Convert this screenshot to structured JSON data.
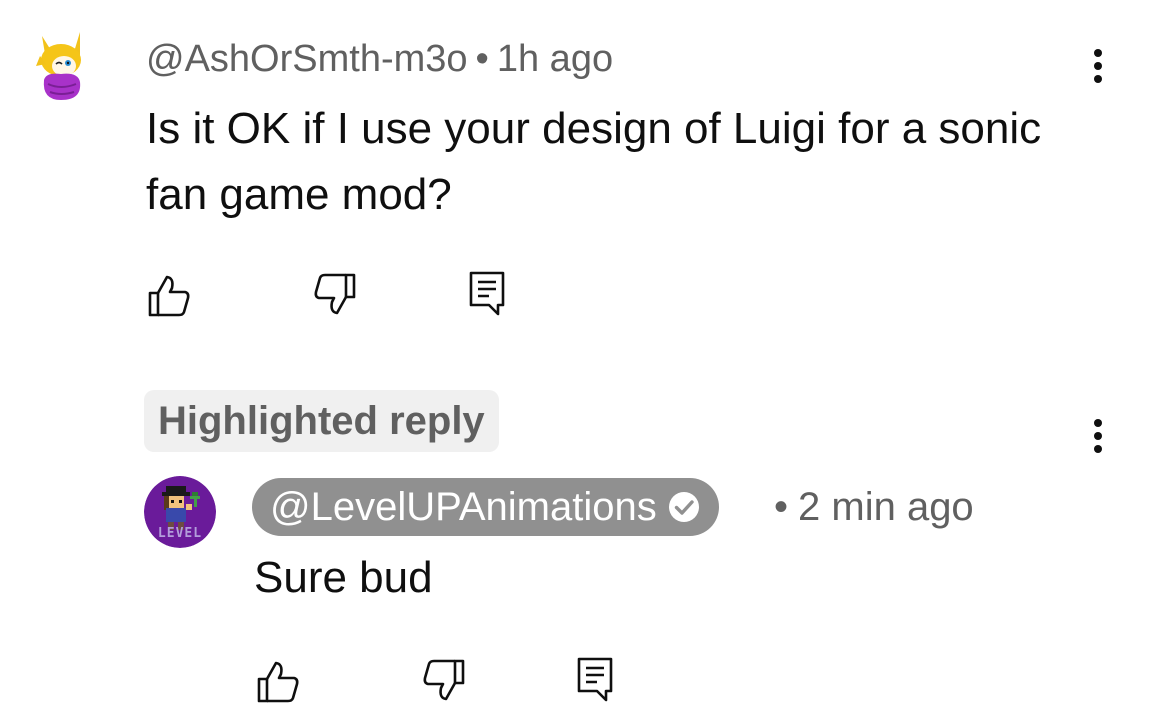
{
  "comment": {
    "author": "@AshOrSmth-m3o",
    "separator": "•",
    "time": "1h ago",
    "text": "Is it OK if I use your design of Luigi for a sonic fan game mod?",
    "avatar_icon": "fox-character-avatar-icon",
    "actions": [
      "like-icon",
      "dislike-icon",
      "reply-icon"
    ],
    "more_icon": "more-vertical-icon"
  },
  "highlighted_label": "Highlighted reply",
  "reply": {
    "author": "@LevelUPAnimations",
    "verified_icon": "verified-check-icon",
    "separator": "•",
    "time": "2 min ago",
    "text": "Sure bud",
    "avatar_text": "LEVEL",
    "avatar_icon": "pixel-character-avatar-icon",
    "actions": [
      "like-icon",
      "dislike-icon",
      "reply-icon"
    ],
    "more_icon": "more-vertical-icon"
  },
  "colors": {
    "author_chip_bg": "#909090",
    "chip_bg": "#f0f0f0",
    "secondary_text": "#606060",
    "avatar2_bg": "#6a1b9a"
  }
}
